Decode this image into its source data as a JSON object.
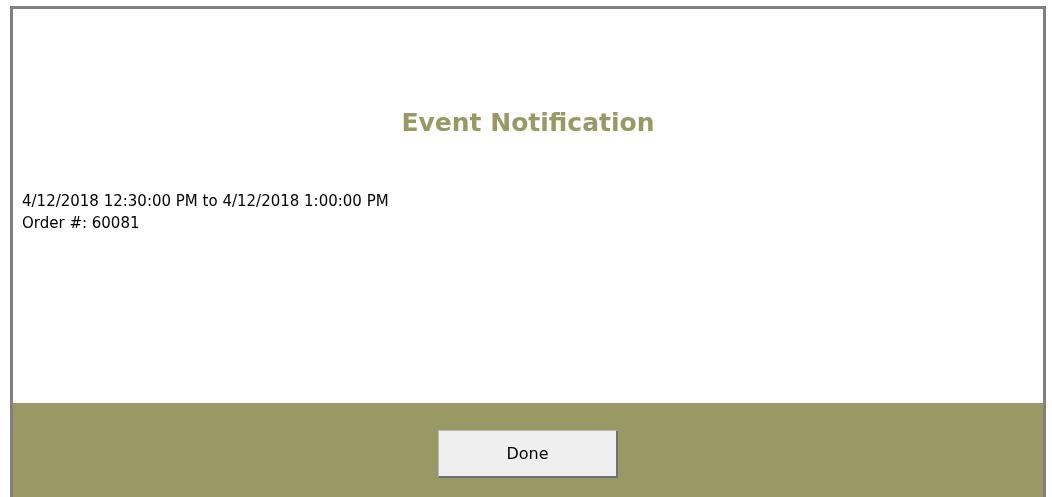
{
  "dialog": {
    "title": "Event Notification",
    "lines": [
      "4/12/2018 12:30:00 PM to 4/12/2018 1:00:00 PM",
      "Order #: 60081"
    ],
    "buttons": [
      "Done"
    ]
  }
}
